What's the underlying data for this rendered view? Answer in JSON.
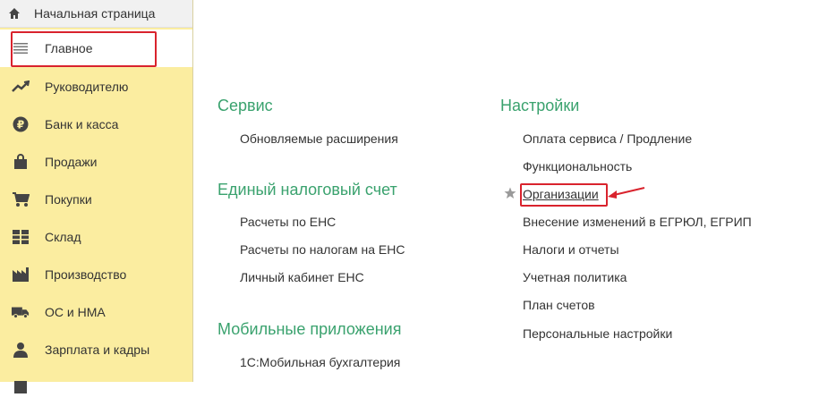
{
  "sidebar": {
    "home_label": "Начальная страница",
    "items": [
      {
        "label": "Главное",
        "icon": "menu-icon"
      },
      {
        "label": "Руководителю",
        "icon": "trend-up-icon"
      },
      {
        "label": "Банк и касса",
        "icon": "ruble-coin-icon"
      },
      {
        "label": "Продажи",
        "icon": "shopping-bag-icon"
      },
      {
        "label": "Покупки",
        "icon": "cart-icon"
      },
      {
        "label": "Склад",
        "icon": "grid-warehouse-icon"
      },
      {
        "label": "Производство",
        "icon": "factory-icon"
      },
      {
        "label": "ОС и НМА",
        "icon": "truck-icon"
      },
      {
        "label": "Зарплата и кадры",
        "icon": "person-icon"
      }
    ]
  },
  "columns": [
    {
      "sections": [
        {
          "title": "Сервис",
          "links": [
            "Обновляемые расширения"
          ]
        },
        {
          "title": "Единый налоговый счет",
          "links": [
            "Расчеты по ЕНС",
            "Расчеты по налогам на ЕНС",
            "Личный кабинет ЕНС"
          ]
        },
        {
          "title": "Мобильные приложения",
          "links": [
            "1С:Мобильная бухгалтерия"
          ]
        }
      ]
    },
    {
      "sections": [
        {
          "title": "Настройки",
          "links": [
            "Оплата сервиса / Продление",
            "Функциональность",
            "Организации",
            "Внесение изменений в ЕГРЮЛ, ЕГРИП",
            "Налоги и отчеты",
            "Учетная политика",
            "План счетов",
            "Персональные настройки"
          ]
        }
      ]
    }
  ],
  "colors": {
    "sidebar_bg": "#fbeda0",
    "section_title": "#3aa26e",
    "highlight_red": "#d9232d"
  }
}
